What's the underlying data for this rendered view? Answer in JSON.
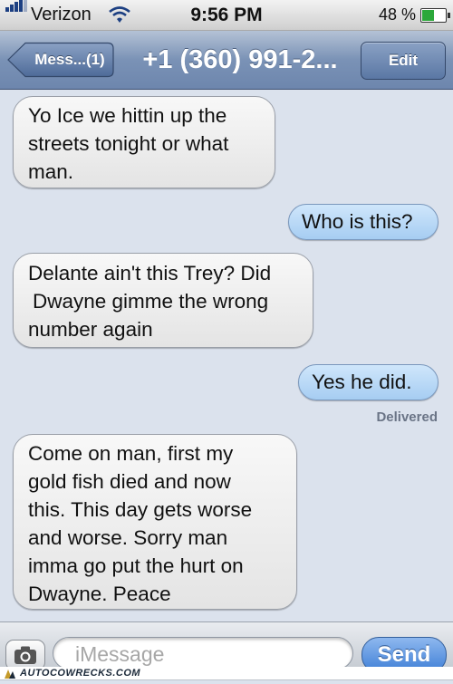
{
  "status_bar": {
    "carrier": "Verizon",
    "time": "9:56 PM",
    "battery_percent": "48 %",
    "battery_level": 0.48
  },
  "nav_bar": {
    "back_label": "Mess...(1)",
    "title": "+1 (360) 991-2...",
    "edit_label": "Edit"
  },
  "messages": [
    {
      "direction": "received",
      "lines": [
        "Yo Ice we hittin up the",
        "streets tonight or what",
        "man."
      ]
    },
    {
      "direction": "sent",
      "lines": [
        "Who is this?"
      ]
    },
    {
      "direction": "received",
      "lines": [
        "Delante ain't this Trey? Did",
        "Dwayne gimme the wrong",
        "number again"
      ]
    },
    {
      "direction": "sent",
      "lines": [
        "Yes he did."
      ],
      "status": "Delivered"
    },
    {
      "direction": "received",
      "lines": [
        "Come on man, first my",
        "gold fish died and now",
        "this. This day gets worse",
        "and worse. Sorry man",
        "imma go put the hurt on",
        "Dwayne. Peace"
      ]
    }
  ],
  "input_bar": {
    "placeholder": "iMessage",
    "send_label": "Send"
  },
  "watermark": {
    "text": "AUTOCOWRECKS.COM"
  },
  "colors": {
    "background": "#dbe2ed",
    "received_bubble": "#ececec",
    "sent_bubble": "#b8d8f6",
    "nav_bar": "#7a92b6",
    "send_button": "#3f7fd6"
  }
}
